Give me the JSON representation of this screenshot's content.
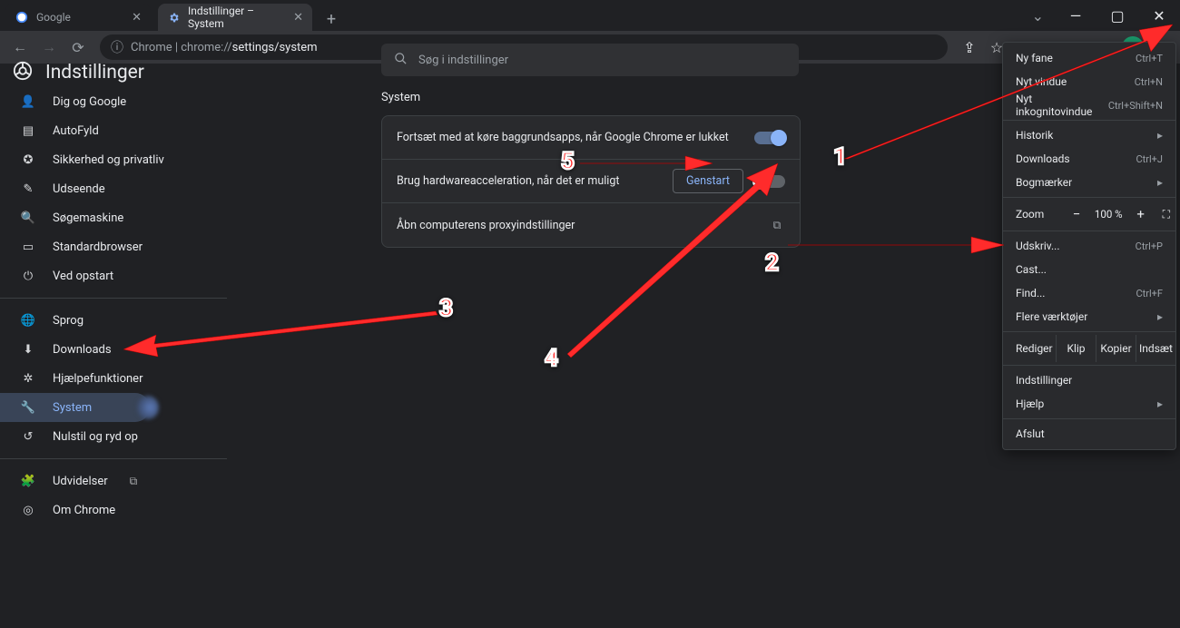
{
  "window": {
    "tabs": [
      {
        "title": "Google",
        "active": false
      },
      {
        "title": "Indstillinger – System",
        "active": true
      }
    ],
    "url_prefix": "Chrome | ",
    "url_host": "chrome://",
    "url_path": "settings/system",
    "win_buttons": {
      "min": "—",
      "max": "▢",
      "close": "✕"
    }
  },
  "settings_header": {
    "title": "Indstillinger",
    "search_placeholder": "Søg i indstillinger"
  },
  "sidebar": {
    "items": [
      {
        "label": "Dig og Google",
        "icon": "person"
      },
      {
        "label": "AutoFyld",
        "icon": "autofill"
      },
      {
        "label": "Sikkerhed og privatliv",
        "icon": "shield"
      },
      {
        "label": "Udseende",
        "icon": "brush"
      },
      {
        "label": "Søgemaskine",
        "icon": "search"
      },
      {
        "label": "Standardbrowser",
        "icon": "browser"
      },
      {
        "label": "Ved opstart",
        "icon": "power"
      }
    ],
    "items2": [
      {
        "label": "Sprog",
        "icon": "globe"
      },
      {
        "label": "Downloads",
        "icon": "download"
      },
      {
        "label": "Hjælpefunktioner",
        "icon": "a11y"
      },
      {
        "label": "System",
        "icon": "wrench",
        "selected": true
      },
      {
        "label": "Nulstil og ryd op",
        "icon": "reset"
      }
    ],
    "items3": [
      {
        "label": "Udvidelser",
        "icon": "puzzle",
        "external": true
      },
      {
        "label": "Om Chrome",
        "icon": "chrome"
      }
    ]
  },
  "main": {
    "section_title": "System",
    "rows": [
      {
        "label": "Fortsæt med at køre baggrundsapps, når Google Chrome er lukket",
        "toggle": true
      },
      {
        "label": "Brug hardwareacceleration, når det er muligt",
        "toggle": false,
        "button": "Genstart"
      },
      {
        "label": "Åbn computerens proxyindstillinger",
        "external": true
      }
    ]
  },
  "appmenu": {
    "items_a": [
      {
        "label": "Ny fane",
        "shortcut": "Ctrl+T"
      },
      {
        "label": "Nyt vindue",
        "shortcut": "Ctrl+N"
      },
      {
        "label": "Nyt inkognitovindue",
        "shortcut": "Ctrl+Shift+N"
      }
    ],
    "items_b": [
      {
        "label": "Historik",
        "submenu": true
      },
      {
        "label": "Downloads",
        "shortcut": "Ctrl+J"
      },
      {
        "label": "Bogmærker",
        "submenu": true
      }
    ],
    "zoom": {
      "label": "Zoom",
      "value": "100 %"
    },
    "items_c": [
      {
        "label": "Udskriv...",
        "shortcut": "Ctrl+P"
      },
      {
        "label": "Cast..."
      },
      {
        "label": "Find...",
        "shortcut": "Ctrl+F"
      },
      {
        "label": "Flere værktøjer",
        "submenu": true
      }
    ],
    "edit": {
      "label": "Rediger",
      "cut": "Klip",
      "copy": "Kopier",
      "paste": "Indsæt"
    },
    "items_d": [
      {
        "label": "Indstillinger"
      },
      {
        "label": "Hjælp",
        "submenu": true
      }
    ],
    "items_e": [
      {
        "label": "Afslut"
      }
    ]
  },
  "annotations": [
    {
      "n": "1"
    },
    {
      "n": "2"
    },
    {
      "n": "3"
    },
    {
      "n": "4"
    },
    {
      "n": "5"
    }
  ]
}
